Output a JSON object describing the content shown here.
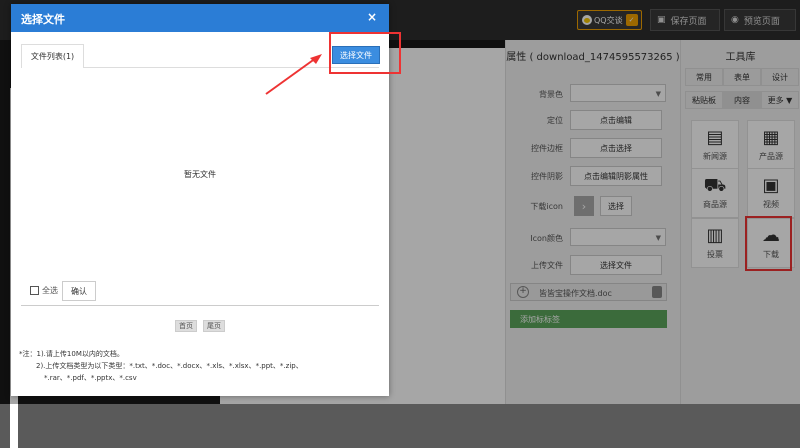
{
  "topbar": {
    "qq_label": "QQ交谈",
    "save_label": "保存页面",
    "preview_label": "预览页面"
  },
  "props": {
    "title": "属性 ( download_1474595573265 )",
    "rows": [
      {
        "label": "背景色",
        "type": "select"
      },
      {
        "label": "定位",
        "button": "点击编辑"
      },
      {
        "label": "控件边框",
        "button": "点击选择"
      },
      {
        "label": "控件阴影",
        "button": "点击编辑阴影属性"
      },
      {
        "label": "下载icon",
        "button": "选择"
      },
      {
        "label": "Icon颜色",
        "type": "select"
      },
      {
        "label": "上传文件",
        "button": "选择文件"
      }
    ],
    "file_name": "皆皆宝操作文档.doc",
    "add_title": "添加标标签"
  },
  "tools": {
    "title": "工具库",
    "tabs_row1": [
      "常用",
      "表单",
      "设计"
    ],
    "tabs_row2": [
      "粘贴板",
      "内容",
      "更多 ▼"
    ],
    "tiles": [
      {
        "label": "新闻源",
        "icon": "newspaper-icon"
      },
      {
        "label": "产品源",
        "icon": "product-icon"
      },
      {
        "label": "商品源",
        "icon": "cart-icon"
      },
      {
        "label": "视频",
        "icon": "video-icon"
      },
      {
        "label": "投票",
        "icon": "chart-icon"
      },
      {
        "label": "下载",
        "icon": "download-cloud-icon"
      }
    ]
  },
  "dialog": {
    "title": "选择文件",
    "close": "×",
    "tab_label": "文件列表(1)",
    "choose_button": "选择文件",
    "empty_text": "暂无文件",
    "select_all": "全选",
    "confirm": "确认",
    "first_page": "首页",
    "last_page": "尾页",
    "note_line1": "*注：1).请上传10M以内的文档。",
    "note_line2": "2).上传文档类型为以下类型：*.txt、*.doc、*.docx、*.xls、*.xlsx、*.ppt、*.zip、",
    "note_line3": "*.rar、*.pdf、*.pptx、*.csv"
  },
  "colors": {
    "dialog_header": "#2b7dd6",
    "highlight": "#ee3333",
    "add_title_bg": "#5ba55b"
  }
}
